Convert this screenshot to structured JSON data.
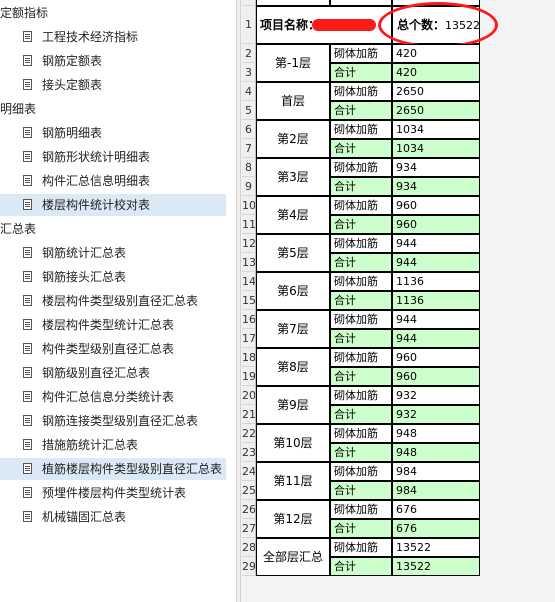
{
  "sidebar": {
    "items": [
      {
        "type": "group",
        "label": "定额指标"
      },
      {
        "type": "item",
        "label": "工程技术经济指标"
      },
      {
        "type": "item",
        "label": "钢筋定额表"
      },
      {
        "type": "item",
        "label": "接头定额表"
      },
      {
        "type": "group",
        "label": "明细表"
      },
      {
        "type": "item",
        "label": "钢筋明细表"
      },
      {
        "type": "item",
        "label": "钢筋形状统计明细表"
      },
      {
        "type": "item",
        "label": "构件汇总信息明细表"
      },
      {
        "type": "item",
        "label": "楼层构件统计校对表",
        "selected": true
      },
      {
        "type": "group",
        "label": "汇总表"
      },
      {
        "type": "item",
        "label": "钢筋统计汇总表"
      },
      {
        "type": "item",
        "label": "钢筋接头汇总表"
      },
      {
        "type": "item",
        "label": "楼层构件类型级别直径汇总表"
      },
      {
        "type": "item",
        "label": "楼层构件类型统计汇总表"
      },
      {
        "type": "item",
        "label": "构件类型级别直径汇总表"
      },
      {
        "type": "item",
        "label": "钢筋级别直径汇总表"
      },
      {
        "type": "item",
        "label": "构件汇总信息分类统计表"
      },
      {
        "type": "item",
        "label": "钢筋连接类型级别直径汇总表"
      },
      {
        "type": "item",
        "label": "措施筋统计汇总表"
      },
      {
        "type": "item",
        "label": "植筋楼层构件类型级别直径汇总表",
        "selected": true
      },
      {
        "type": "item",
        "label": "预埋件楼层构件类型统计表"
      },
      {
        "type": "item",
        "label": "机械锚固汇总表"
      }
    ]
  },
  "sheet": {
    "project_label": "项目名称：",
    "total_label": "总个数：",
    "total_value": "13522",
    "row_numbers": [
      "1",
      "2",
      "3",
      "4",
      "5",
      "6",
      "7",
      "8",
      "9",
      "10",
      "11",
      "12",
      "13",
      "14",
      "15",
      "16",
      "17",
      "18",
      "19",
      "20",
      "21",
      "22",
      "23",
      "24",
      "25",
      "26",
      "27",
      "28",
      "29"
    ],
    "floors": [
      {
        "name": "第-1层",
        "type": "砌体加筋",
        "value": "420",
        "total_label": "合计",
        "total": "420"
      },
      {
        "name": "首层",
        "type": "砌体加筋",
        "value": "2650",
        "total_label": "合计",
        "total": "2650"
      },
      {
        "name": "第2层",
        "type": "砌体加筋",
        "value": "1034",
        "total_label": "合计",
        "total": "1034"
      },
      {
        "name": "第3层",
        "type": "砌体加筋",
        "value": "934",
        "total_label": "合计",
        "total": "934"
      },
      {
        "name": "第4层",
        "type": "砌体加筋",
        "value": "960",
        "total_label": "合计",
        "total": "960"
      },
      {
        "name": "第5层",
        "type": "砌体加筋",
        "value": "944",
        "total_label": "合计",
        "total": "944"
      },
      {
        "name": "第6层",
        "type": "砌体加筋",
        "value": "1136",
        "total_label": "合计",
        "total": "1136"
      },
      {
        "name": "第7层",
        "type": "砌体加筋",
        "value": "944",
        "total_label": "合计",
        "total": "944"
      },
      {
        "name": "第8层",
        "type": "砌体加筋",
        "value": "960",
        "total_label": "合计",
        "total": "960"
      },
      {
        "name": "第9层",
        "type": "砌体加筋",
        "value": "932",
        "total_label": "合计",
        "total": "932"
      },
      {
        "name": "第10层",
        "type": "砌体加筋",
        "value": "948",
        "total_label": "合计",
        "total": "948"
      },
      {
        "name": "第11层",
        "type": "砌体加筋",
        "value": "984",
        "total_label": "合计",
        "total": "984"
      },
      {
        "name": "第12层",
        "type": "砌体加筋",
        "value": "676",
        "total_label": "合计",
        "total": "676"
      },
      {
        "name": "全部层汇总",
        "type": "砌体加筋",
        "value": "13522",
        "total_label": "合计",
        "total": "13522"
      }
    ]
  },
  "colors": {
    "total_row_bg": "#ccffcc",
    "annotation_red": "#ff1a1a",
    "selection_bg": "#dbe8f6"
  }
}
